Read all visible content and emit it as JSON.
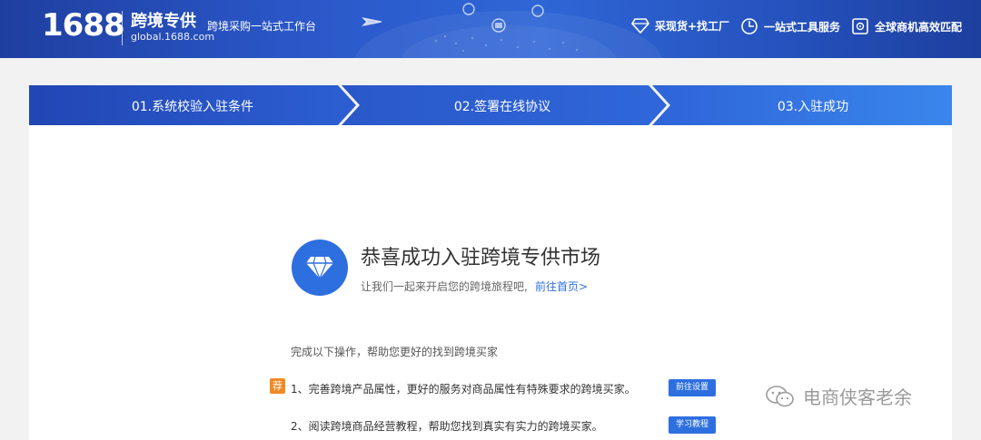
{
  "header": {
    "logo_number": "1688",
    "logo_name": "跨境专供",
    "logo_domain": "global.1688.com",
    "tagline": "跨境采购一站式工作台",
    "nav": [
      {
        "label": "采现货+找工厂",
        "icon": "diamond-icon"
      },
      {
        "label": "一站式工具服务",
        "icon": "clock-icon"
      },
      {
        "label": "全球商机高效匹配",
        "icon": "target-icon"
      }
    ]
  },
  "steps": [
    {
      "label": "01.系统校验入驻条件"
    },
    {
      "label": "02.签署在线协议"
    },
    {
      "label": "03.入驻成功"
    }
  ],
  "success": {
    "title": "恭喜成功入驻跨境专供市场",
    "subtitle": "让我们一起来开启您的跨境旅程吧,",
    "home_link": "前往首页>"
  },
  "todo": {
    "intro": "完成以下操作，帮助您更好的找到跨境买家",
    "badge": "荐",
    "items": [
      {
        "text": "1、完善跨境产品属性，更好的服务对商品属性有特殊要求的跨境买家。",
        "button": "前往设置"
      },
      {
        "text": "2、阅读跨境商品经营教程，帮助您找到真实有实力的跨境买家。",
        "button": "学习教程"
      }
    ]
  },
  "watermark": "电商侠客老余",
  "colors": {
    "header_blue": "#2a57c8",
    "step_blue": "#2e6fe0",
    "accent": "#2e6fe0",
    "badge_orange": "#f08a24"
  }
}
